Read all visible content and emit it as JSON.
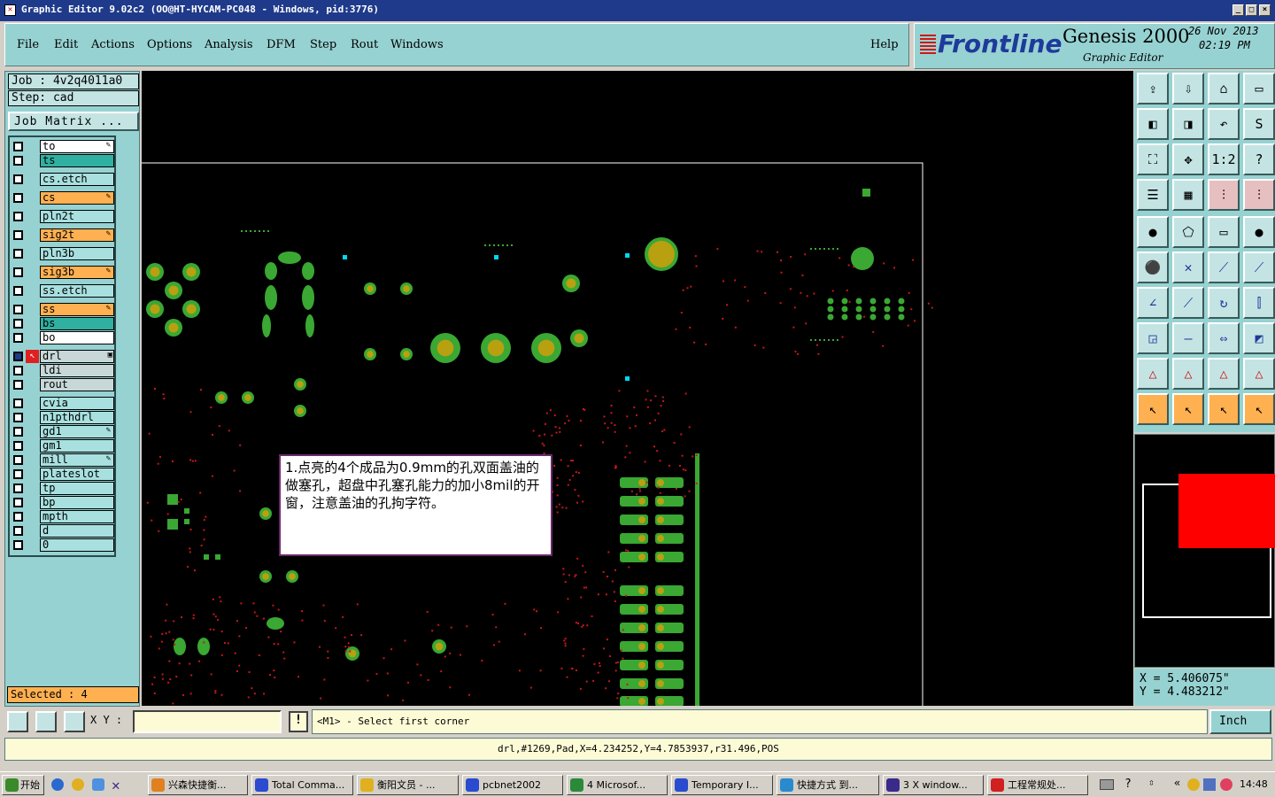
{
  "window": {
    "title": "Graphic Editor 9.02c2 (OO@HT-HYCAM-PC048 - Windows, pid:3776)",
    "btn_min": "_",
    "btn_max": "□",
    "btn_close": "×"
  },
  "menu": {
    "items": [
      "File",
      "Edit",
      "Actions",
      "Options",
      "Analysis",
      "DFM",
      "Step",
      "Rout",
      "Windows"
    ],
    "help": "Help"
  },
  "brand": {
    "logo": "Frontline",
    "product": "Genesis 2000",
    "subtitle": "Graphic Editor",
    "date": "26 Nov 2013",
    "time": "02:19 PM"
  },
  "job": {
    "job_label": "Job : 4v2q4011a0",
    "step_label": "Step: cad",
    "matrix_button": "Job Matrix ..."
  },
  "layers": [
    {
      "name": "to",
      "style": "white",
      "arrow": true
    },
    {
      "name": "ts",
      "style": "green"
    },
    {
      "name": "cs.etch",
      "style": "cyan"
    },
    {
      "name": "cs",
      "style": "orange",
      "arrow": true
    },
    {
      "name": "pln2t",
      "style": "cyan"
    },
    {
      "name": "sig2t",
      "style": "orange",
      "arrow": true
    },
    {
      "name": "pln3b",
      "style": "cyan"
    },
    {
      "name": "sig3b",
      "style": "orange",
      "arrow": true
    },
    {
      "name": "ss.etch",
      "style": "cyan"
    },
    {
      "name": "ss",
      "style": "orange",
      "arrow": true
    },
    {
      "name": "bs",
      "style": "green"
    },
    {
      "name": "bo",
      "style": "white"
    },
    {
      "name": "drl",
      "style": "gray",
      "active": true
    },
    {
      "name": "ldi",
      "style": "gray"
    },
    {
      "name": "rout",
      "style": "gray"
    },
    {
      "name": "cvia",
      "style": "cyan"
    },
    {
      "name": "n1pthdrl",
      "style": "cyan"
    },
    {
      "name": "gd1",
      "style": "cyan",
      "arrow": true
    },
    {
      "name": "gm1",
      "style": "cyan"
    },
    {
      "name": "mill",
      "style": "cyan",
      "arrow": true
    },
    {
      "name": "plateslot",
      "style": "cyan"
    },
    {
      "name": "tp",
      "style": "cyan"
    },
    {
      "name": "bp",
      "style": "cyan"
    },
    {
      "name": "mpth",
      "style": "cyan"
    },
    {
      "name": "d",
      "style": "cyan"
    },
    {
      "name": "0",
      "style": "cyan"
    }
  ],
  "selected": "Selected : 4",
  "note": {
    "text": "1.点亮的4个成品为0.9mm的孔双面盖油的做塞孔，超盘中孔塞孔能力的加小8mil的开窗，注意盖油的孔拘字符。"
  },
  "coords": {
    "x": "X = 5.406075\"",
    "y": "Y = 4.483212\""
  },
  "bottom": {
    "xy_label": "X Y :",
    "xy_value": "",
    "prompt": "<M1> - Select first corner",
    "units": "Inch"
  },
  "status": "drl,#1269,Pad,X=4.234252,Y=4.7853937,r31.496,POS",
  "taskbar": {
    "start": "开始",
    "tasks": [
      "兴森快捷衡...",
      "Total Comma...",
      "衡阳文员 - ...",
      "pcbnet2002",
      "4 Microsof...",
      "Temporary I...",
      "快捷方式 到...",
      "3 X window...",
      "工程常规处..."
    ],
    "clock": "14:48"
  },
  "colors": {
    "pad": "#3aa832",
    "pad_center": "#b8a010",
    "red_dot": "#c81818",
    "cyan_dot": "#00d8f0",
    "panel": "#97d2d2",
    "accent": "#ffb050"
  },
  "icons": [
    "home-up-icon",
    "home-down-icon",
    "home-icon",
    "window-icon",
    "pan-left-icon",
    "pan-right-icon",
    "undo-zoom-icon",
    "snap-icon",
    "zoom-fit-icon",
    "zoom-center-icon",
    "one-to-one-icon",
    "help-icon",
    "settings-icon",
    "grid-icon",
    "layers-red-icon",
    "layers-red2-icon",
    "pad-icon",
    "edit-shape-icon",
    "measure-icon",
    "dot-icon",
    "connect-icon",
    "cross-icon",
    "line-icon",
    "line2-icon",
    "angle-icon",
    "slash-icon",
    "arc-icon",
    "mirror-icon",
    "square-point-icon",
    "minus-icon",
    "move-icon",
    "shapes-icon",
    "triangle-1-icon",
    "triangle-2-icon",
    "triangle-3-icon",
    "triangle-4-icon",
    "select-icon",
    "select2-icon",
    "select3-icon",
    "select4-icon"
  ]
}
